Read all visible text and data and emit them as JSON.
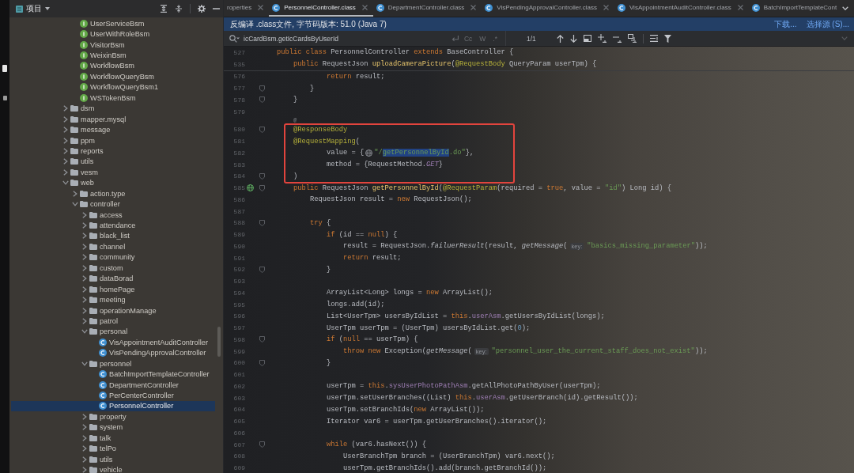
{
  "sidebar": {
    "title": "项目",
    "tree_continued": [
      {
        "label": "UserServiceBsm",
        "kind": "interface",
        "selected": false
      },
      {
        "label": "UserWithRoleBsm",
        "kind": "interface",
        "selected": false
      },
      {
        "label": "VisitorBsm",
        "kind": "interface",
        "selected": false
      },
      {
        "label": "WeixinBsm",
        "kind": "interface",
        "selected": false
      },
      {
        "label": "WorkflowBsm",
        "kind": "interface",
        "selected": false
      },
      {
        "label": "WorkflowQueryBsm",
        "kind": "interface",
        "selected": false
      },
      {
        "label": "WorkflowQueryBsm1",
        "kind": "interface",
        "selected": false
      },
      {
        "label": "WSTokenBsm",
        "kind": "interface",
        "selected": false
      }
    ],
    "tree": [
      {
        "label": "dsm",
        "kind": "folder",
        "expanded": false,
        "selected": false
      },
      {
        "label": "mapper.mysql",
        "kind": "folder",
        "expanded": false,
        "selected": false
      },
      {
        "label": "message",
        "kind": "folder",
        "expanded": false,
        "selected": false
      },
      {
        "label": "ppm",
        "kind": "folder",
        "expanded": false,
        "selected": false
      },
      {
        "label": "reports",
        "kind": "folder",
        "expanded": false,
        "selected": false
      },
      {
        "label": "utils",
        "kind": "folder",
        "expanded": false,
        "selected": false
      },
      {
        "label": "vesm",
        "kind": "folder",
        "expanded": false,
        "selected": false
      },
      {
        "label": "web",
        "kind": "folder",
        "expanded": true,
        "selected": false,
        "children": [
          {
            "label": "action.type",
            "kind": "folder",
            "expanded": false,
            "selected": false
          },
          {
            "label": "controller",
            "kind": "folder",
            "expanded": true,
            "selected": false,
            "children": [
              {
                "label": "access",
                "kind": "folder",
                "expanded": false,
                "selected": false
              },
              {
                "label": "attendance",
                "kind": "folder",
                "expanded": false,
                "selected": false
              },
              {
                "label": "black_list",
                "kind": "folder",
                "expanded": false,
                "selected": false
              },
              {
                "label": "channel",
                "kind": "folder",
                "expanded": false,
                "selected": false
              },
              {
                "label": "community",
                "kind": "folder",
                "expanded": false,
                "selected": false
              },
              {
                "label": "custom",
                "kind": "folder",
                "expanded": false,
                "selected": false
              },
              {
                "label": "dataBorad",
                "kind": "folder",
                "expanded": false,
                "selected": false
              },
              {
                "label": "homePage",
                "kind": "folder",
                "expanded": false,
                "selected": false
              },
              {
                "label": "meeting",
                "kind": "folder",
                "expanded": false,
                "selected": false
              },
              {
                "label": "operationManage",
                "kind": "folder",
                "expanded": false,
                "selected": false
              },
              {
                "label": "patrol",
                "kind": "folder",
                "expanded": false,
                "selected": false
              },
              {
                "label": "personal",
                "kind": "folder",
                "expanded": true,
                "selected": false,
                "children": [
                  {
                    "label": "VisAppointmentAuditController",
                    "kind": "class",
                    "selected": false
                  },
                  {
                    "label": "VisPendingApprovalController",
                    "kind": "class",
                    "selected": false
                  }
                ]
              },
              {
                "label": "personnel",
                "kind": "folder",
                "expanded": true,
                "selected": false,
                "children": [
                  {
                    "label": "BatchImportTemplateController",
                    "kind": "class",
                    "selected": false
                  },
                  {
                    "label": "DepartmentController",
                    "kind": "class",
                    "selected": false
                  },
                  {
                    "label": "PerCenterController",
                    "kind": "class",
                    "selected": false
                  },
                  {
                    "label": "PersonnelController",
                    "kind": "class",
                    "selected": true
                  }
                ]
              },
              {
                "label": "property",
                "kind": "folder",
                "expanded": false,
                "selected": false
              },
              {
                "label": "system",
                "kind": "folder",
                "expanded": false,
                "selected": false
              },
              {
                "label": "talk",
                "kind": "folder",
                "expanded": false,
                "selected": false
              },
              {
                "label": "telPo",
                "kind": "folder",
                "expanded": false,
                "selected": false
              },
              {
                "label": "utils",
                "kind": "folder",
                "expanded": false,
                "selected": false
              },
              {
                "label": "vehicle",
                "kind": "folder",
                "expanded": false,
                "selected": false
              }
            ]
          }
        ]
      }
    ]
  },
  "tabs": [
    {
      "label": "roperties",
      "kind": "plain",
      "selected": false,
      "closable": true
    },
    {
      "label": "PersonnelController.class",
      "kind": "class",
      "selected": true,
      "closable": true
    },
    {
      "label": "DepartmentController.class",
      "kind": "class",
      "selected": false,
      "closable": true
    },
    {
      "label": "VisPendingApprovalController.class",
      "kind": "class",
      "selected": false,
      "closable": true
    },
    {
      "label": "VisAppointmentAuditController.class",
      "kind": "class",
      "selected": false,
      "closable": true
    },
    {
      "label": "BatchImportTemplateCont",
      "kind": "class",
      "selected": false,
      "closable": false
    }
  ],
  "banner": {
    "text": "反编译 .class文件, 字节码版本: 51.0 (Java 7)",
    "links": [
      "下载...",
      "选择源 (S)..."
    ]
  },
  "search": {
    "value": "icCardBsm.getIcCardsByUserId",
    "options": [
      "Cc",
      "W",
      ".*"
    ],
    "match_count": "1/1"
  },
  "editor": {
    "annotations": [
      {
        "kind": "frame"
      }
    ],
    "sticky_lines": [
      {
        "number": "527",
        "tokens": [
          {
            "kind": "kw",
            "text": "public class"
          },
          {
            "kind": "p",
            "text": " PersonnelController "
          },
          {
            "kind": "kw",
            "text": "extends"
          },
          {
            "kind": "p",
            "text": " BaseController {"
          }
        ]
      },
      {
        "number": "535",
        "tokens": [
          {
            "kind": "kw",
            "text": "    public"
          },
          {
            "kind": "p",
            "text": " RequestJson "
          },
          {
            "kind": "fn",
            "text": "uploadCameraPicture"
          },
          {
            "kind": "p",
            "text": "("
          },
          {
            "kind": "ann",
            "text": "@RequestBody"
          },
          {
            "kind": "p",
            "text": " QueryParam userTpm) {"
          }
        ]
      }
    ],
    "lines": [
      {
        "kind": "code",
        "number": "576",
        "fold": false,
        "tokens": [
          {
            "kind": "kw",
            "text": "            return"
          },
          {
            "kind": "p",
            "text": " result;"
          }
        ]
      },
      {
        "kind": "code",
        "number": "577",
        "fold": true,
        "tokens": [
          {
            "kind": "p",
            "text": "        }"
          }
        ]
      },
      {
        "kind": "code",
        "number": "578",
        "fold": true,
        "tokens": [
          {
            "kind": "p",
            "text": "    }"
          }
        ]
      },
      {
        "kind": "code",
        "number": "579",
        "fold": false
      },
      {
        "kind": "inlay",
        "text": "    @"
      },
      {
        "kind": "code",
        "number": "580",
        "fold": true,
        "tokens": [
          {
            "kind": "ann",
            "text": "    @ResponseBody"
          }
        ]
      },
      {
        "kind": "code",
        "number": "581",
        "fold": false,
        "tokens": [
          {
            "kind": "ann",
            "text": "    @RequestMapping"
          },
          {
            "kind": "p",
            "text": "("
          }
        ]
      },
      {
        "kind": "code",
        "number": "582",
        "fold": false,
        "tokens": [
          {
            "kind": "p",
            "text": "            value = {"
          },
          {
            "kind": "icon"
          },
          {
            "kind": "str",
            "text": "\"/"
          },
          {
            "kind": "sel",
            "text": "getPersonnelById"
          },
          {
            "kind": "str",
            "text": ".do\""
          },
          {
            "kind": "p",
            "text": "},"
          }
        ]
      },
      {
        "kind": "code",
        "number": "583",
        "fold": false,
        "tokens": [
          {
            "kind": "p",
            "text": "            method = {RequestMethod."
          },
          {
            "kind": "const",
            "text": "GET"
          },
          {
            "kind": "p",
            "text": "}"
          }
        ]
      },
      {
        "kind": "code",
        "number": "584",
        "fold": true,
        "tokens": [
          {
            "kind": "p",
            "text": "    )"
          }
        ]
      },
      {
        "kind": "code",
        "number": "585",
        "fold": true,
        "gutter": {
          "kind": "endpoint"
        },
        "tokens": [
          {
            "kind": "kw",
            "text": "    public"
          },
          {
            "kind": "p",
            "text": " RequestJson "
          },
          {
            "kind": "fn",
            "text": "getPersonnelById"
          },
          {
            "kind": "p",
            "text": "("
          },
          {
            "kind": "ann",
            "text": "@RequestParam"
          },
          {
            "kind": "p",
            "text": "(required = "
          },
          {
            "kind": "kw",
            "text": "true"
          },
          {
            "kind": "p",
            "text": ", value = "
          },
          {
            "kind": "str",
            "text": "\"id\""
          },
          {
            "kind": "p",
            "text": ") Long id) {"
          }
        ]
      },
      {
        "kind": "code",
        "number": "586",
        "fold": false,
        "tokens": [
          {
            "kind": "p",
            "text": "        RequestJson result = "
          },
          {
            "kind": "kw",
            "text": "new"
          },
          {
            "kind": "p",
            "text": " RequestJson();"
          }
        ]
      },
      {
        "kind": "code",
        "number": "587",
        "fold": false
      },
      {
        "kind": "code",
        "number": "588",
        "fold": true,
        "tokens": [
          {
            "kind": "kw",
            "text": "        try"
          },
          {
            "kind": "p",
            "text": " {"
          }
        ]
      },
      {
        "kind": "code",
        "number": "589",
        "fold": false,
        "tokens": [
          {
            "kind": "kw",
            "text": "            if"
          },
          {
            "kind": "p",
            "text": " (id == "
          },
          {
            "kind": "kw",
            "text": "null"
          },
          {
            "kind": "p",
            "text": ") {"
          }
        ]
      },
      {
        "kind": "code",
        "number": "590",
        "fold": false,
        "tokens": [
          {
            "kind": "p",
            "text": "                result = RequestJson."
          },
          {
            "kind": "it",
            "text": "failuerResult"
          },
          {
            "kind": "p",
            "text": "(result, "
          },
          {
            "kind": "it",
            "text": "getMessage"
          },
          {
            "kind": "p",
            "text": "("
          },
          {
            "kind": "hint",
            "text": "key:"
          },
          {
            "kind": "str",
            "text": "\"basics_missing_parameter\""
          },
          {
            "kind": "p",
            "text": "));"
          }
        ]
      },
      {
        "kind": "code",
        "number": "591",
        "fold": false,
        "tokens": [
          {
            "kind": "kw",
            "text": "                return"
          },
          {
            "kind": "p",
            "text": " result;"
          }
        ]
      },
      {
        "kind": "code",
        "number": "592",
        "fold": true,
        "tokens": [
          {
            "kind": "p",
            "text": "            }"
          }
        ]
      },
      {
        "kind": "code",
        "number": "593",
        "fold": false
      },
      {
        "kind": "code",
        "number": "594",
        "fold": false,
        "tokens": [
          {
            "kind": "p",
            "text": "            ArrayList<Long> longs = "
          },
          {
            "kind": "kw",
            "text": "new"
          },
          {
            "kind": "p",
            "text": " ArrayList();"
          }
        ]
      },
      {
        "kind": "code",
        "number": "595",
        "fold": false,
        "tokens": [
          {
            "kind": "p",
            "text": "            longs.add(id);"
          }
        ]
      },
      {
        "kind": "code",
        "number": "596",
        "fold": false,
        "tokens": [
          {
            "kind": "p",
            "text": "            List<UserTpm> usersByIdList = "
          },
          {
            "kind": "kw",
            "text": "this"
          },
          {
            "kind": "p",
            "text": "."
          },
          {
            "kind": "field",
            "text": "userAsm"
          },
          {
            "kind": "p",
            "text": ".getUsersByIdList(longs);"
          }
        ]
      },
      {
        "kind": "code",
        "number": "597",
        "fold": false,
        "tokens": [
          {
            "kind": "p",
            "text": "            UserTpm userTpm = (UserTpm) usersByIdList.get("
          },
          {
            "kind": "num",
            "text": "0"
          },
          {
            "kind": "p",
            "text": ");"
          }
        ]
      },
      {
        "kind": "code",
        "number": "598",
        "fold": true,
        "tokens": [
          {
            "kind": "kw",
            "text": "            if"
          },
          {
            "kind": "p",
            "text": " ("
          },
          {
            "kind": "kw",
            "text": "null"
          },
          {
            "kind": "p",
            "text": " == userTpm) {"
          }
        ]
      },
      {
        "kind": "code",
        "number": "599",
        "fold": false,
        "tokens": [
          {
            "kind": "kw",
            "text": "                throw new"
          },
          {
            "kind": "p",
            "text": " Exception("
          },
          {
            "kind": "it",
            "text": "getMessage"
          },
          {
            "kind": "p",
            "text": "("
          },
          {
            "kind": "hint",
            "text": "key:"
          },
          {
            "kind": "str",
            "text": "\"personnel_user_the_current_staff_does_not_exist\""
          },
          {
            "kind": "p",
            "text": "));"
          }
        ]
      },
      {
        "kind": "code",
        "number": "600",
        "fold": true,
        "tokens": [
          {
            "kind": "p",
            "text": "            }"
          }
        ]
      },
      {
        "kind": "code",
        "number": "601",
        "fold": false
      },
      {
        "kind": "code",
        "number": "602",
        "fold": false,
        "tokens": [
          {
            "kind": "p",
            "text": "            userTpm = "
          },
          {
            "kind": "kw",
            "text": "this"
          },
          {
            "kind": "p",
            "text": "."
          },
          {
            "kind": "field",
            "text": "sysUserPhotoPathAsm"
          },
          {
            "kind": "p",
            "text": ".getAllPhotoPathByUser(userTpm);"
          }
        ]
      },
      {
        "kind": "code",
        "number": "603",
        "fold": false,
        "tokens": [
          {
            "kind": "p",
            "text": "            userTpm.setUserBranches((List) "
          },
          {
            "kind": "kw",
            "text": "this"
          },
          {
            "kind": "p",
            "text": "."
          },
          {
            "kind": "field",
            "text": "userAsm"
          },
          {
            "kind": "p",
            "text": ".getUserBranch(id).getResult());"
          }
        ]
      },
      {
        "kind": "code",
        "number": "604",
        "fold": false,
        "tokens": [
          {
            "kind": "p",
            "text": "            userTpm.setBranchIds("
          },
          {
            "kind": "kw",
            "text": "new"
          },
          {
            "kind": "p",
            "text": " ArrayList());"
          }
        ]
      },
      {
        "kind": "code",
        "number": "605",
        "fold": false,
        "tokens": [
          {
            "kind": "p",
            "text": "            Iterator var6 = userTpm.getUserBranches().iterator();"
          }
        ]
      },
      {
        "kind": "code",
        "number": "606",
        "fold": false
      },
      {
        "kind": "code",
        "number": "607",
        "fold": true,
        "tokens": [
          {
            "kind": "kw",
            "text": "            while"
          },
          {
            "kind": "p",
            "text": " (var6.hasNext()) {"
          }
        ]
      },
      {
        "kind": "code",
        "number": "608",
        "fold": false,
        "tokens": [
          {
            "kind": "p",
            "text": "                UserBranchTpm branch = (UserBranchTpm) var6.next();"
          }
        ]
      },
      {
        "kind": "code",
        "number": "609",
        "fold": false,
        "tokens": [
          {
            "kind": "p",
            "text": "                userTpm.getBranchIds().add(branch.getBranchId());"
          }
        ]
      }
    ]
  }
}
